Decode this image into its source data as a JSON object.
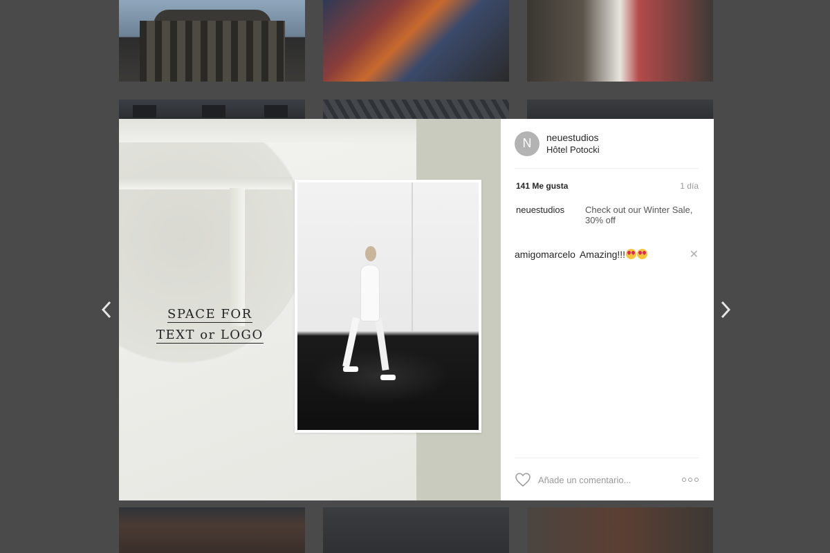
{
  "post": {
    "avatar_letter": "N",
    "username": "neuestudios",
    "location": "Hôtel Potocki",
    "likes": "141 Me gusta",
    "time": "1 día",
    "caption": {
      "user": "neuestudios",
      "text": "Check out our Winter Sale, 30% off"
    },
    "comments": [
      {
        "user": "amigomarcelo",
        "text": "Amazing!!!"
      }
    ],
    "comment_placeholder": "Añade un comentario..."
  },
  "media": {
    "overlay_line1": "SPACE FOR",
    "overlay_line2": "TEXT or LOGO"
  },
  "colors": {
    "backdrop": "#4a4a4a",
    "avatar": "#b3b3b3",
    "sage_panel": "#c8cbbd"
  },
  "icons": {
    "prev": "chevron-left-icon",
    "next": "chevron-right-icon",
    "like": "heart-icon",
    "remove_comment": "close-icon",
    "more": "more-options-icon"
  }
}
